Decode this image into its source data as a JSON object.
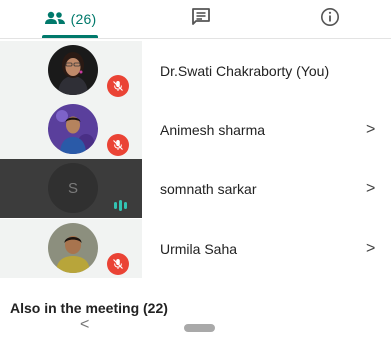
{
  "tabs": {
    "people_count": "(26)",
    "people_icon": "people-icon",
    "chat_icon": "chat-icon",
    "info_icon": "info-icon",
    "accent": "#00796b"
  },
  "participants": [
    {
      "name": "Dr.Swati Chakraborty (You)",
      "muted": true,
      "has_chevron": false
    },
    {
      "name": "Animesh sharma",
      "muted": true,
      "has_chevron": true
    },
    {
      "name": "somnath sarkar",
      "initial": "S",
      "muted": false,
      "speaking": true,
      "has_chevron": true
    },
    {
      "name": "Urmila Saha",
      "muted": true,
      "has_chevron": true
    }
  ],
  "chevron": ">",
  "also_in_meeting": "Also in the meeting (22)",
  "nav": {
    "back": "<"
  },
  "colors": {
    "mute_badge": "#ea4335",
    "speaking": "#33c2b3"
  }
}
